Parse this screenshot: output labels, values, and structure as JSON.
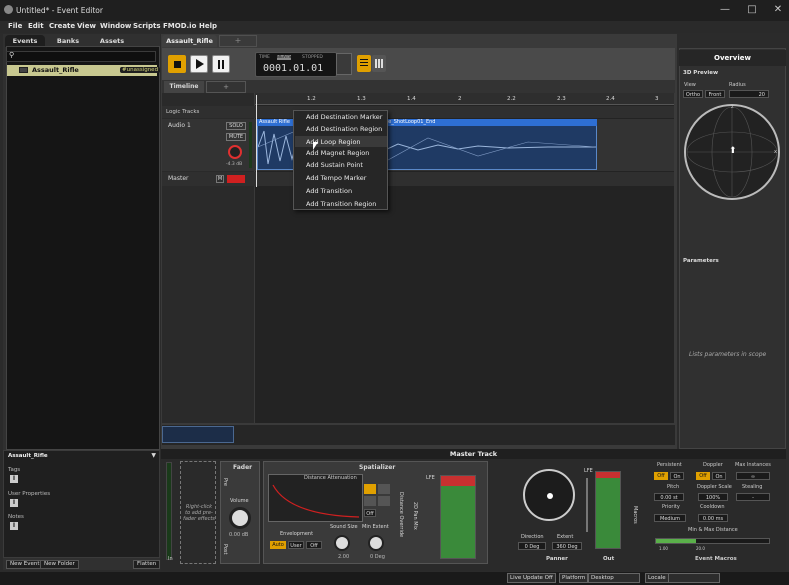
{
  "window": {
    "title": "Untitled* - Event Editor",
    "minimize": "—",
    "maximize": "□",
    "close": "✕"
  },
  "menu": [
    "File",
    "Edit",
    "Create",
    "View",
    "Window",
    "Scripts",
    "FMOD.io",
    "Help"
  ],
  "left_tabs": [
    "Events",
    "Banks",
    "Assets"
  ],
  "event_browser": {
    "event_name": "Assault_Rifle",
    "badge": "#unassigned"
  },
  "properties": {
    "title": "Assault_Rifle",
    "tags": "Tags",
    "user_properties": "User Properties",
    "notes": "Notes",
    "buttons": [
      "New Event",
      "New Folder",
      "Flatten"
    ]
  },
  "editor": {
    "tab": "Assault_Rifle",
    "add_tab": "+",
    "time_modes": [
      "TIME",
      "BEATS",
      "STOPPED"
    ],
    "time_value": "0001.01.01",
    "timeline_tab": "Timeline",
    "ruler": [
      "1.2",
      "1.3",
      "1.4",
      "2",
      "2.2",
      "2.3",
      "2.4",
      "3"
    ],
    "logic_tracks": "Logic Tracks",
    "audio_track": "Audio 1",
    "solo": "SOLO",
    "mute": "MUTE",
    "volume": "-4.3 dB",
    "master": "Master",
    "m": "M",
    "region_label": "Assault Rifle",
    "region_label2": "fle_ShotLoop01_End"
  },
  "context_menu": [
    "Add Destination Marker",
    "Add Destination Region",
    "Add Loop Region",
    "Add Magnet Region",
    "Add Sustain Point",
    "Add Tempo Marker",
    "Add Transition",
    "Add Transition Region"
  ],
  "overview": {
    "title": "Overview",
    "preview": "3D Preview",
    "view": "View",
    "radius": "Radius",
    "ortho": "Ortho",
    "front": "Front",
    "radius_value": "20",
    "z": "z",
    "x": "x",
    "parameters": "Parameters",
    "params_empty": "Lists parameters in scope"
  },
  "master_track": {
    "title": "Master Track",
    "pre_fader_hint": "Right-click to add pre-fader effects",
    "fader": "Fader",
    "pre": "Pre",
    "post": "Post",
    "volume": "Volume",
    "volume_value": "0.00 dB",
    "spatializer": "Spatializer",
    "distance_att": "Distance Attenuation",
    "envelopment": "Envelopment",
    "env_buttons": [
      "Auto",
      "User",
      "Off"
    ],
    "sound_size": "Sound Size",
    "sound_size_v": "2.00",
    "min_extent": "Min Extent",
    "min_extent_v": "0 Deg",
    "distance_override": "Distance Override",
    "pan_mix": "2D Pan Mix",
    "off": "Off",
    "lfe": "LFE",
    "in": "In",
    "direction": "Direction",
    "direction_v": "0 Deg",
    "extent": "Extent",
    "extent_v": "360 Deg",
    "panner": "Panner",
    "out": "Out",
    "macros": "Macros",
    "persistent": "Persistent",
    "doppler": "Doppler",
    "max_instances": "Max Instances",
    "on": "On",
    "off2": "Off",
    "infinity": "∞",
    "pitch": "Pitch",
    "pitch_v": "0.00 st",
    "doppler_scale": "Doppler Scale",
    "doppler_scale_v": "100%",
    "stealing": "Stealing",
    "stealing_v": "-",
    "priority": "Priority",
    "priority_v": "Medium",
    "cooldown": "Cooldown",
    "cooldown_v": "0.00 ms",
    "minmax": "Min & Max Distance",
    "min_v": "1.00",
    "max_v": "20.0",
    "event_macros": "Event Macros"
  },
  "status": {
    "live_update": "Live Update Off",
    "platform_label": "Platform",
    "platform": "Desktop",
    "locale_label": "Locale"
  }
}
